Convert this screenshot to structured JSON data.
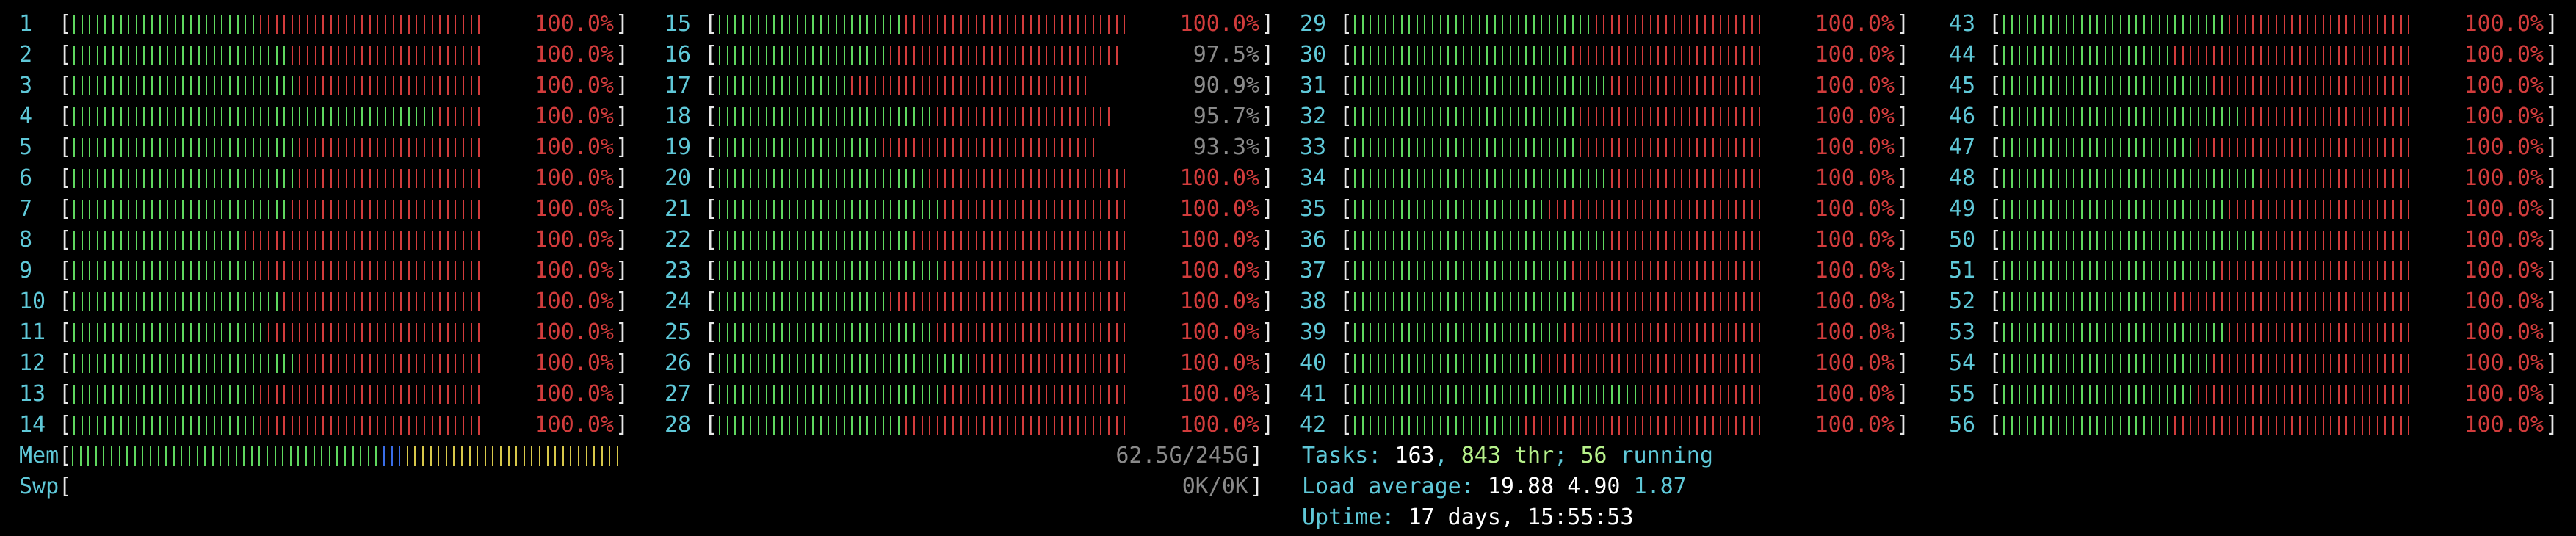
{
  "cpus": [
    {
      "id": "1",
      "value": "100.0%",
      "green_fraction": 0.45
    },
    {
      "id": "2",
      "value": "100.0%",
      "green_fraction": 0.52
    },
    {
      "id": "3",
      "value": "100.0%",
      "green_fraction": 0.55
    },
    {
      "id": "4",
      "value": "100.0%",
      "green_fraction": 0.88
    },
    {
      "id": "5",
      "value": "100.0%",
      "green_fraction": 0.55
    },
    {
      "id": "6",
      "value": "100.0%",
      "green_fraction": 0.55
    },
    {
      "id": "7",
      "value": "100.0%",
      "green_fraction": 0.52
    },
    {
      "id": "8",
      "value": "100.0%",
      "green_fraction": 0.42
    },
    {
      "id": "9",
      "value": "100.0%",
      "green_fraction": 0.45
    },
    {
      "id": "10",
      "value": "100.0%",
      "green_fraction": 0.5
    },
    {
      "id": "11",
      "value": "100.0%",
      "green_fraction": 0.48
    },
    {
      "id": "12",
      "value": "100.0%",
      "green_fraction": 0.55
    },
    {
      "id": "13",
      "value": "100.0%",
      "green_fraction": 0.45
    },
    {
      "id": "14",
      "value": "100.0%",
      "green_fraction": 0.45
    },
    {
      "id": "15",
      "value": "100.0%",
      "green_fraction": 0.45
    },
    {
      "id": "16",
      "value": "97.5%",
      "green_fraction": 0.42
    },
    {
      "id": "17",
      "value": "90.9%",
      "green_fraction": 0.35
    },
    {
      "id": "18",
      "value": "95.7%",
      "green_fraction": 0.55
    },
    {
      "id": "19",
      "value": "93.3%",
      "green_fraction": 0.42
    },
    {
      "id": "20",
      "value": "100.0%",
      "green_fraction": 0.5
    },
    {
      "id": "21",
      "value": "100.0%",
      "green_fraction": 0.55
    },
    {
      "id": "22",
      "value": "100.0%",
      "green_fraction": 0.48
    },
    {
      "id": "23",
      "value": "100.0%",
      "green_fraction": 0.55
    },
    {
      "id": "24",
      "value": "100.0%",
      "green_fraction": 0.42
    },
    {
      "id": "25",
      "value": "100.0%",
      "green_fraction": 0.52
    },
    {
      "id": "26",
      "value": "100.0%",
      "green_fraction": 0.62
    },
    {
      "id": "27",
      "value": "100.0%",
      "green_fraction": 0.55
    },
    {
      "id": "28",
      "value": "100.0%",
      "green_fraction": 0.45
    },
    {
      "id": "29",
      "value": "100.0%",
      "green_fraction": 0.58
    },
    {
      "id": "30",
      "value": "100.0%",
      "green_fraction": 0.52
    },
    {
      "id": "31",
      "value": "100.0%",
      "green_fraction": 0.62
    },
    {
      "id": "32",
      "value": "100.0%",
      "green_fraction": 0.55
    },
    {
      "id": "33",
      "value": "100.0%",
      "green_fraction": 0.55
    },
    {
      "id": "34",
      "value": "100.0%",
      "green_fraction": 0.62
    },
    {
      "id": "35",
      "value": "100.0%",
      "green_fraction": 0.48
    },
    {
      "id": "36",
      "value": "100.0%",
      "green_fraction": 0.62
    },
    {
      "id": "37",
      "value": "100.0%",
      "green_fraction": 0.52
    },
    {
      "id": "38",
      "value": "100.0%",
      "green_fraction": 0.55
    },
    {
      "id": "39",
      "value": "100.0%",
      "green_fraction": 0.5
    },
    {
      "id": "40",
      "value": "100.0%",
      "green_fraction": 0.45
    },
    {
      "id": "41",
      "value": "100.0%",
      "green_fraction": 0.7
    },
    {
      "id": "42",
      "value": "100.0%",
      "green_fraction": 0.42
    },
    {
      "id": "43",
      "value": "100.0%",
      "green_fraction": 0.55
    },
    {
      "id": "44",
      "value": "100.0%",
      "green_fraction": 0.42
    },
    {
      "id": "45",
      "value": "100.0%",
      "green_fraction": 0.5
    },
    {
      "id": "46",
      "value": "100.0%",
      "green_fraction": 0.58
    },
    {
      "id": "47",
      "value": "100.0%",
      "green_fraction": 0.48
    },
    {
      "id": "48",
      "value": "100.0%",
      "green_fraction": 0.62
    },
    {
      "id": "49",
      "value": "100.0%",
      "green_fraction": 0.55
    },
    {
      "id": "50",
      "value": "100.0%",
      "green_fraction": 0.62
    },
    {
      "id": "51",
      "value": "100.0%",
      "green_fraction": 0.52
    },
    {
      "id": "52",
      "value": "100.0%",
      "green_fraction": 0.42
    },
    {
      "id": "53",
      "value": "100.0%",
      "green_fraction": 0.55
    },
    {
      "id": "54",
      "value": "100.0%",
      "green_fraction": 0.5
    },
    {
      "id": "55",
      "value": "100.0%",
      "green_fraction": 0.48
    },
    {
      "id": "56",
      "value": "100.0%",
      "green_fraction": 0.42
    }
  ],
  "memory": {
    "label": "Mem",
    "value": "62.5G/245G",
    "segments": [
      {
        "color": "green",
        "fraction": 0.56
      },
      {
        "color": "blue",
        "fraction": 0.04
      },
      {
        "color": "yellow",
        "fraction": 0.4
      }
    ]
  },
  "swap": {
    "label": "Swp",
    "value": "0K/0K"
  },
  "tasks": {
    "label": "Tasks: ",
    "count": "163",
    "sep1": ", ",
    "threads": "843",
    "thr_label": " thr",
    "sep2": "; ",
    "running": "56",
    "running_label": " running"
  },
  "load": {
    "label": "Load average: ",
    "one": "19.88",
    "five": "4.90",
    "fifteen": "1.87"
  },
  "uptime": {
    "label": "Uptime: ",
    "value": "17 days, 15:55:53"
  },
  "colors": {
    "green": "#5fd75f",
    "red": "#d23c3c",
    "cyan": "#5fc8d8",
    "yellow": "#d7c84a",
    "blue": "#3a6ee8"
  }
}
